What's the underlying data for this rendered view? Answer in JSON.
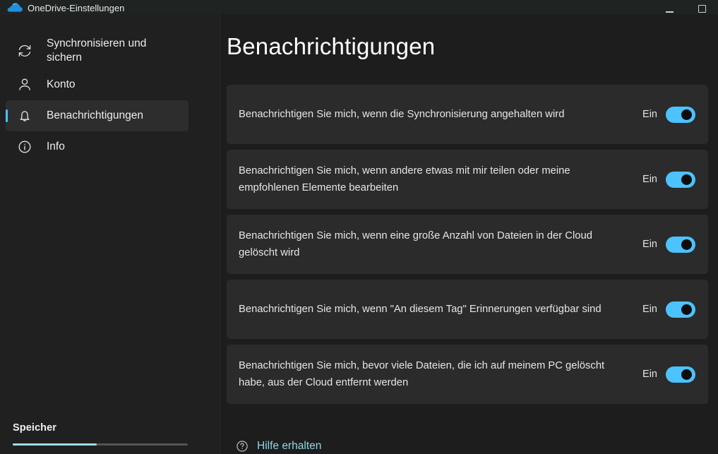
{
  "window": {
    "title": "OneDrive-Einstellungen",
    "app_icon": "onedrive-cloud-icon",
    "minimize_label": "Minimieren",
    "maximize_label": "Maximieren"
  },
  "sidebar": {
    "items": [
      {
        "label": "Synchronisieren und sichern",
        "icon": "sync-icon",
        "selected": false
      },
      {
        "label": "Konto",
        "icon": "person-icon",
        "selected": false
      },
      {
        "label": "Benachrichtigungen",
        "icon": "bell-icon",
        "selected": true
      },
      {
        "label": "Info",
        "icon": "info-circle-icon",
        "selected": false
      }
    ],
    "storage": {
      "label": "Speicher",
      "fill_percent": 48
    }
  },
  "main": {
    "title": "Benachrichtigungen",
    "settings": [
      {
        "label": "Benachrichtigen Sie mich, wenn die Synchronisierung angehalten wird",
        "state_label": "Ein",
        "on": true
      },
      {
        "label": "Benachrichtigen Sie mich, wenn andere etwas mit mir teilen oder meine empfohlenen Elemente bearbeiten",
        "state_label": "Ein",
        "on": true
      },
      {
        "label": "Benachrichtigen Sie mich, wenn eine große Anzahl von Dateien in der Cloud gelöscht wird",
        "state_label": "Ein",
        "on": true
      },
      {
        "label": "Benachrichtigen Sie mich, wenn \"An diesem Tag\" Erinnerungen verfügbar sind",
        "state_label": "Ein",
        "on": true
      },
      {
        "label": "Benachrichtigen Sie mich, bevor viele Dateien, die ich auf meinem PC gelöscht habe, aus der Cloud entfernt werden",
        "state_label": "Ein",
        "on": true
      }
    ],
    "help": {
      "label": "Hilfe erhalten",
      "icon": "question-circle-icon"
    }
  },
  "colors": {
    "accent": "#4cc2ff",
    "toggle_on": "#4cc2ff",
    "link": "#8fd6e8",
    "storage_fill": "#9fdcf2",
    "card_bg": "#2b2b2b",
    "sidebar_bg": "#202020",
    "content_bg": "#1d1d1d"
  }
}
